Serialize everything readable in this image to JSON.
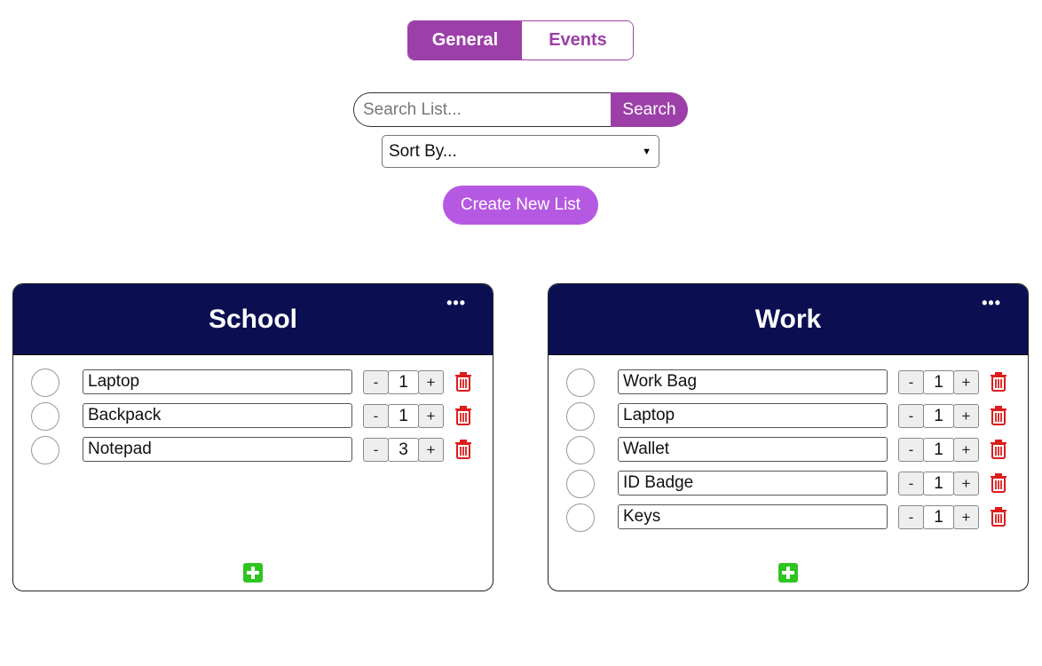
{
  "tabs": [
    {
      "label": "General",
      "active": true
    },
    {
      "label": "Events",
      "active": false
    }
  ],
  "search": {
    "placeholder": "Search List...",
    "value": "",
    "button_label": "Search"
  },
  "sort": {
    "selected": "Sort By..."
  },
  "create_button_label": "Create New List",
  "colors": {
    "accent": "#9d3fa8",
    "create": "#b659e2",
    "card_header": "#0b0f52",
    "delete": "#dd1c1c",
    "add": "#2ec51f"
  },
  "icons": {
    "more": "ellipsis-icon",
    "delete": "trash-icon",
    "add": "plus-square-icon",
    "check": "circle-checkbox-icon"
  },
  "lists": [
    {
      "title": "School",
      "more_label": "•••",
      "items": [
        {
          "name": "Laptop",
          "qty": "1"
        },
        {
          "name": "Backpack",
          "qty": "1"
        },
        {
          "name": "Notepad",
          "qty": "3"
        }
      ]
    },
    {
      "title": "Work",
      "more_label": "•••",
      "items": [
        {
          "name": "Work Bag",
          "qty": "1"
        },
        {
          "name": "Laptop",
          "qty": "1"
        },
        {
          "name": "Wallet",
          "qty": "1"
        },
        {
          "name": "ID Badge",
          "qty": "1"
        },
        {
          "name": "Keys",
          "qty": "1"
        }
      ]
    }
  ],
  "qty_controls": {
    "minus": "-",
    "plus": "+"
  }
}
